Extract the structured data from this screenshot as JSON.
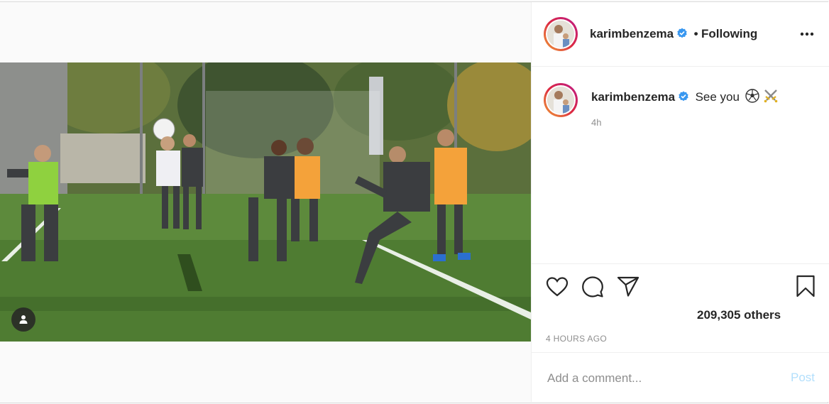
{
  "post": {
    "author": {
      "username": "karimbenzema",
      "verified": true,
      "follow_state": "Following",
      "separator": "•"
    },
    "caption": {
      "username": "karimbenzema",
      "text": "See you",
      "emojis": [
        "soccer-ball-emoji",
        "crossed-swords-emoji"
      ],
      "relative_time": "4h"
    },
    "likes": {
      "text": "209,305 others"
    },
    "timestamp": "4 HOURS AGO",
    "comment": {
      "placeholder": "Add a comment...",
      "post_label": "Post"
    }
  },
  "icons": {
    "more": "more-options-icon",
    "like": "heart-icon",
    "comment": "comment-icon",
    "share": "share-icon",
    "save": "bookmark-icon",
    "tagged_people": "person-tag-icon",
    "verified": "verified-badge-icon"
  },
  "colors": {
    "verified_blue": "#3897f0",
    "post_button_disabled": "#b2dffc",
    "secondary_text": "#8e8e8e",
    "primary_text": "#262626"
  }
}
